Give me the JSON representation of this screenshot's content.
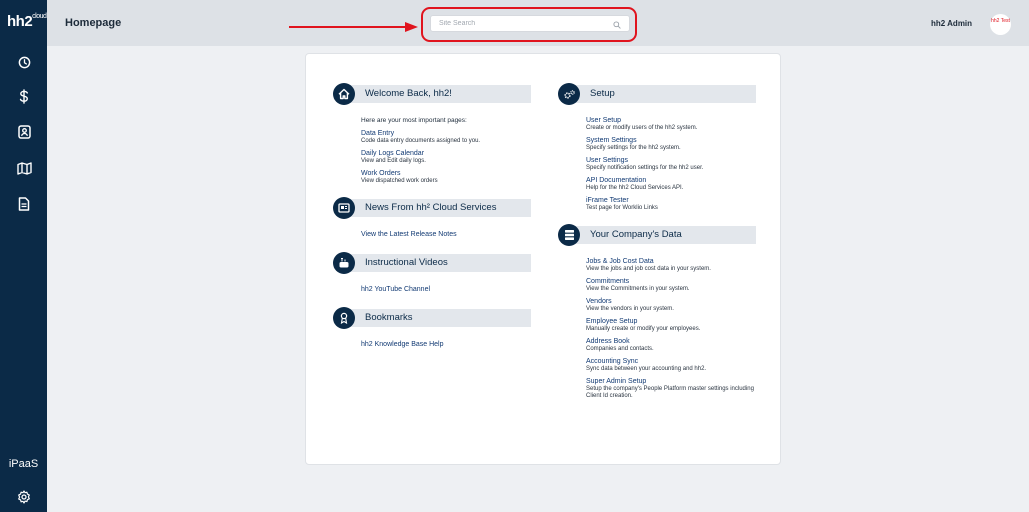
{
  "app": {
    "logo": "hh2",
    "logo_suffix": "cloud"
  },
  "sidebar": {
    "items": [
      {
        "icon": "clock-icon"
      },
      {
        "icon": "dollar-icon"
      },
      {
        "icon": "contacts-icon"
      },
      {
        "icon": "map-icon"
      },
      {
        "icon": "document-icon"
      }
    ],
    "ipaas_label": "iPaaS",
    "settings_icon": "gear-icon"
  },
  "header": {
    "title": "Homepage",
    "search": {
      "placeholder": "Site Search",
      "value": ""
    },
    "user_name": "hh2 Admin",
    "avatar_text": "hh2 Test"
  },
  "colors": {
    "navy": "#0b2a47",
    "highlight": "#e0141e",
    "link": "#123a73"
  },
  "left": {
    "welcome": {
      "title": "Welcome Back, hh2!",
      "intro": "Here are your most important pages:",
      "items": [
        {
          "title": "Data Entry",
          "desc": "Code data entry documents assigned to you."
        },
        {
          "title": "Daily Logs Calendar",
          "desc": "View and Edit daily logs."
        },
        {
          "title": "Work Orders",
          "desc": "View dispatched work orders"
        }
      ]
    },
    "news": {
      "title": "News From hh² Cloud Services",
      "link": "View the Latest Release Notes"
    },
    "videos": {
      "title": "Instructional Videos",
      "link": "hh2 YouTube Channel"
    },
    "bookmarks": {
      "title": "Bookmarks",
      "link": "hh2 Knowledge Base Help"
    }
  },
  "right": {
    "setup": {
      "title": "Setup",
      "items": [
        {
          "title": "User Setup",
          "desc": "Create or modify users of the hh2 system."
        },
        {
          "title": "System Settings",
          "desc": "Specify settings for the hh2 system."
        },
        {
          "title": "User Settings",
          "desc": "Specify notification settings for the hh2 user."
        },
        {
          "title": "API Documentation",
          "desc": "Help for the hh2 Cloud Services API."
        },
        {
          "title": "iFrame Tester",
          "desc": "Test page for Worklio Links"
        }
      ]
    },
    "company": {
      "title": "Your Company's Data",
      "items": [
        {
          "title": "Jobs & Job Cost Data",
          "desc": "View the jobs and job cost data in your system."
        },
        {
          "title": "Commitments",
          "desc": "View the Commitments in your system."
        },
        {
          "title": "Vendors",
          "desc": "View the vendors in your system."
        },
        {
          "title": "Employee Setup",
          "desc": "Manually create or modify your employees."
        },
        {
          "title": "Address Book",
          "desc": "Companies and contacts."
        },
        {
          "title": "Accounting Sync",
          "desc": "Sync data between your accounting and hh2."
        },
        {
          "title": "Super Admin Setup",
          "desc": "Setup the company's People Platform master settings including Client Id creation."
        }
      ]
    }
  }
}
